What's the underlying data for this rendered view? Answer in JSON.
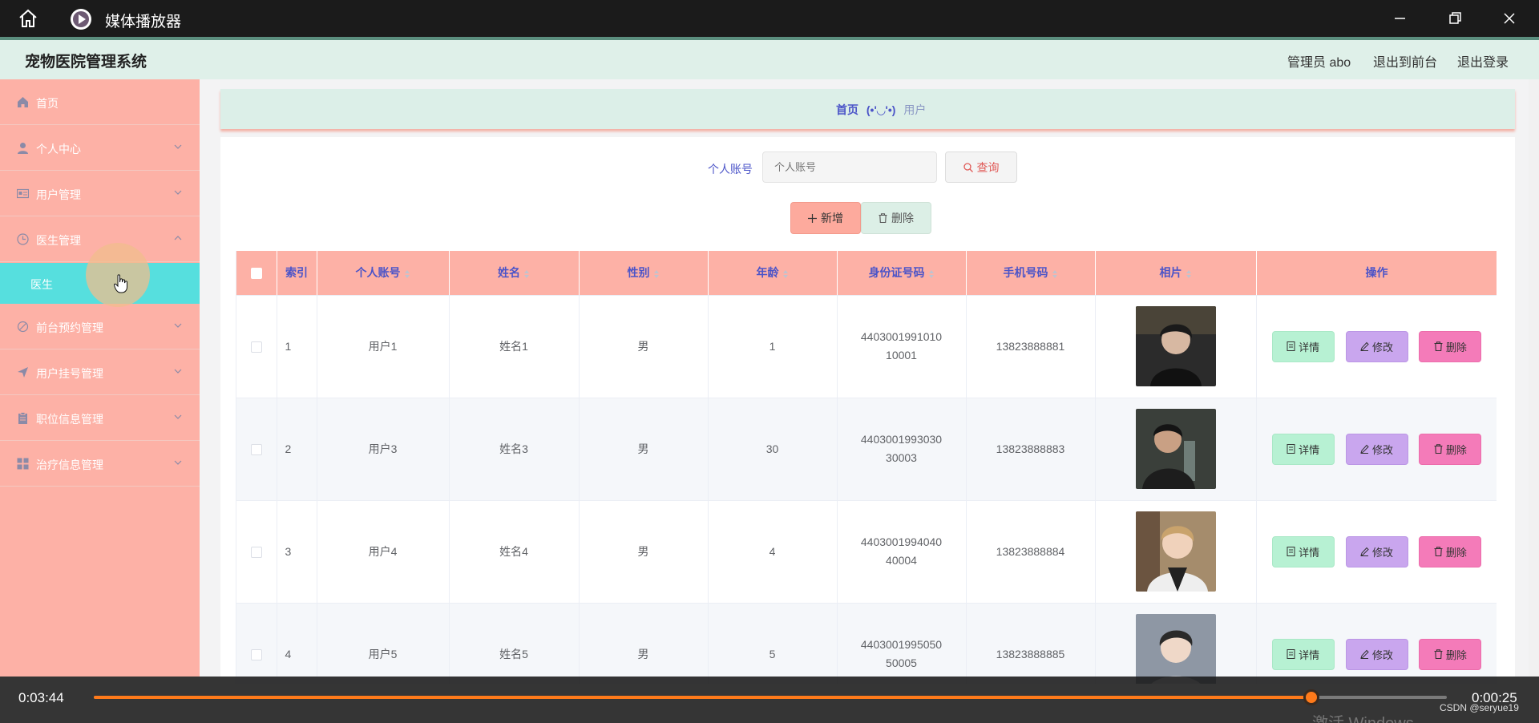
{
  "player": {
    "title": "媒体播放器",
    "time_elapsed": "0:03:44",
    "time_remaining": "0:00:25",
    "progress": 0.9,
    "watermark": "CSDN @seryue19",
    "activate_text": "激活 Windows"
  },
  "header": {
    "system_title": "宠物医院管理系统",
    "admin_label": "管理员 abo",
    "to_frontend": "退出到前台",
    "logout": "退出登录"
  },
  "sidebar": {
    "items": [
      {
        "label": "首页",
        "icon": "home-icon"
      },
      {
        "label": "个人中心",
        "icon": "user-icon"
      },
      {
        "label": "用户管理",
        "icon": "id-card-icon"
      },
      {
        "label": "医生管理",
        "icon": "clock-icon"
      },
      {
        "label": "前台预约管理",
        "icon": "no-icon"
      },
      {
        "label": "用户挂号管理",
        "icon": "send-icon"
      },
      {
        "label": "职位信息管理",
        "icon": "clipboard-icon"
      },
      {
        "label": "治疗信息管理",
        "icon": "grid-icon"
      }
    ],
    "sub_item": "医生"
  },
  "breadcrumb": {
    "home": "首页",
    "separator": "(•'◡'•)",
    "current": "用户"
  },
  "search": {
    "label": "个人账号",
    "placeholder": "个人账号",
    "button": "查询"
  },
  "actions": {
    "add": "新增",
    "delete": "删除"
  },
  "table": {
    "columns": [
      "索引",
      "个人账号",
      "姓名",
      "性别",
      "年龄",
      "身份证号码",
      "手机号码",
      "相片",
      "操作"
    ],
    "rows": [
      {
        "index": "1",
        "account": "用户1",
        "name": "姓名1",
        "gender": "男",
        "age": "1",
        "id_card": "440300199101010001",
        "phone": "13823888881"
      },
      {
        "index": "2",
        "account": "用户3",
        "name": "姓名3",
        "gender": "男",
        "age": "30",
        "id_card": "440300199303030003",
        "phone": "13823888883"
      },
      {
        "index": "3",
        "account": "用户4",
        "name": "姓名4",
        "gender": "男",
        "age": "4",
        "id_card": "440300199404040004",
        "phone": "13823888884"
      },
      {
        "index": "4",
        "account": "用户5",
        "name": "姓名5",
        "gender": "男",
        "age": "5",
        "id_card": "440300199505050005",
        "phone": "13823888885"
      }
    ],
    "op_detail": "详情",
    "op_edit": "修改",
    "op_delete": "删除"
  },
  "colors": {
    "sidebar_bg": "#fdb1a6",
    "active_sub_bg": "#56dfde",
    "header_bg": "#dff0e9",
    "accent_text": "#4b54c8",
    "progress": "#ff7a1a"
  }
}
